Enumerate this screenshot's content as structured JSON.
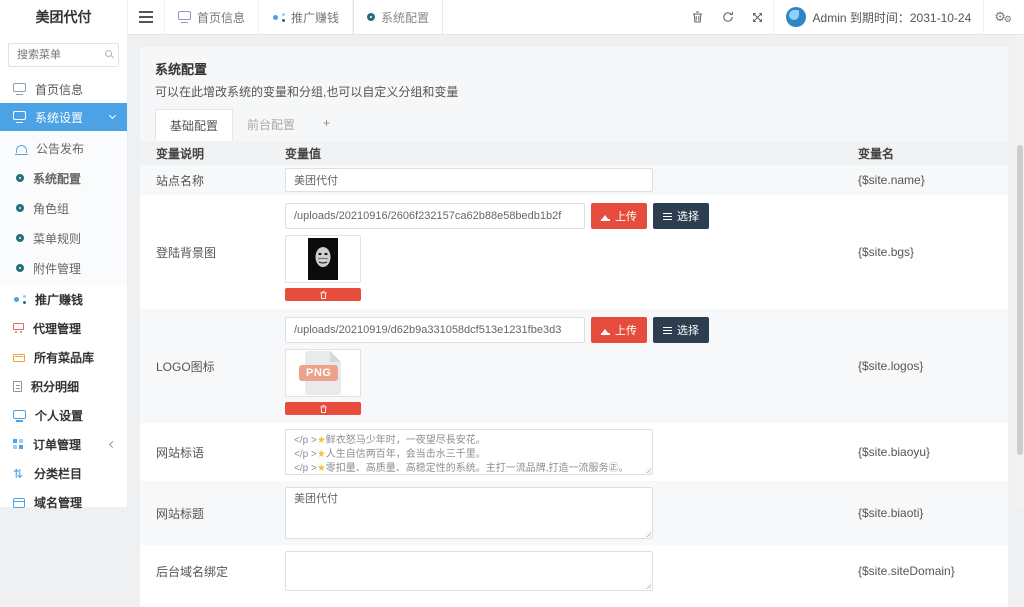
{
  "app": {
    "logo": "美团代付"
  },
  "sidebar": {
    "search_placeholder": "搜索菜单",
    "items": [
      {
        "label": "首页信息"
      },
      {
        "label": "系统设置"
      },
      {
        "label": "公告发布"
      },
      {
        "label": "系统配置"
      },
      {
        "label": "角色组"
      },
      {
        "label": "菜单规则"
      },
      {
        "label": "附件管理"
      },
      {
        "label": "推广赚钱"
      },
      {
        "label": "代理管理"
      },
      {
        "label": "所有菜品库"
      },
      {
        "label": "积分明细"
      },
      {
        "label": "个人设置"
      },
      {
        "label": "订单管理"
      },
      {
        "label": "分类栏目"
      },
      {
        "label": "域名管理"
      }
    ]
  },
  "topbar": {
    "tabs": [
      {
        "label": "首页信息"
      },
      {
        "label": "推广赚钱"
      },
      {
        "label": "系统配置"
      }
    ],
    "user_text": "Admin 到期时间：2031-10-24"
  },
  "icons": {
    "cog": "⚙",
    "sort": "⇅"
  },
  "page": {
    "title": "系统配置",
    "subtitle": "可以在此增改系统的变量和分组,也可以自定义分组和变量",
    "tabs": [
      {
        "label": "基础配置"
      },
      {
        "label": "前台配置"
      },
      {
        "label": "+"
      }
    ]
  },
  "buttons": {
    "upload": "上传",
    "choose": "选择"
  },
  "table": {
    "headers": [
      "变量说明",
      "变量值",
      "变量名"
    ],
    "rows": [
      {
        "label": "站点名称",
        "value": "美团代付",
        "var": "{$site.name}"
      },
      {
        "label": "登陆背景图",
        "path": "/uploads/20210916/2606f232157ca62b88e58bedb1b2f",
        "var": "{$site.bgs}"
      },
      {
        "label": "LOGO图标",
        "path": "/uploads/20210919/d62b9a331058dcf513e1231fbe3d3",
        "badge": "PNG",
        "var": "{$site.logos}"
      },
      {
        "label": "网站标语",
        "var": "{$site.biaoyu}",
        "lines": [
          {
            "pre": "</p >",
            "star": "★",
            "text": "鲜衣怒马少年时，一夜望尽長安花。"
          },
          {
            "pre": "</p >",
            "star": "★",
            "text": "人生自信两百年，会当击水三千里。"
          },
          {
            "pre": "</p >",
            "star": "★",
            "text": "零扣量、高质量、高稳定性的系统。主打一流品牌,打造一流服务㊣。"
          }
        ]
      },
      {
        "label": "网站标题",
        "value": "美团代付",
        "var": "{$site.biaoti}"
      },
      {
        "label": "后台域名绑定",
        "value": "",
        "var": "{$site.siteDomain}"
      }
    ]
  },
  "colors": {
    "accent": "#4ba2e4",
    "danger": "#e74c3c",
    "navy": "#2c3e50",
    "teal": "#23707e"
  }
}
